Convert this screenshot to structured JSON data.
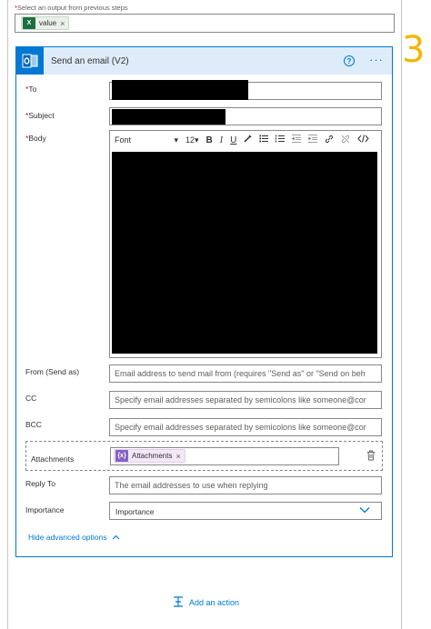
{
  "previous": {
    "label": "Select an output from previous steps",
    "token": "value"
  },
  "page_number": "3",
  "card": {
    "title": "Send an email (V2)",
    "help": "?",
    "more": "···"
  },
  "fields": {
    "to_label": "To",
    "subject_label": "Subject",
    "body_label": "Body",
    "from_label": "From (Send as)",
    "from_placeholder": "Email address to send mail from (requires \"Send as\" or \"Send on beh",
    "cc_label": "CC",
    "cc_placeholder": "Specify email addresses separated by semicolons like someone@cor",
    "bcc_label": "BCC",
    "bcc_placeholder": "Specify email addresses separated by semicolons like someone@cor",
    "attachments_label": "Attachments",
    "attachments_token": "Attachments",
    "reply_to_label": "Reply To",
    "reply_to_placeholder": "The email addresses to use when replying",
    "importance_label": "Importance",
    "importance_value": "Importance"
  },
  "toolbar": {
    "font": "Font",
    "size": "12"
  },
  "hide_advanced": "Hide advanced options",
  "add_action": "Add an action",
  "colors": {
    "accent": "#0078d4",
    "required": "#a4262c",
    "header_bg": "#deecf9",
    "page_number": "#f2b705"
  }
}
